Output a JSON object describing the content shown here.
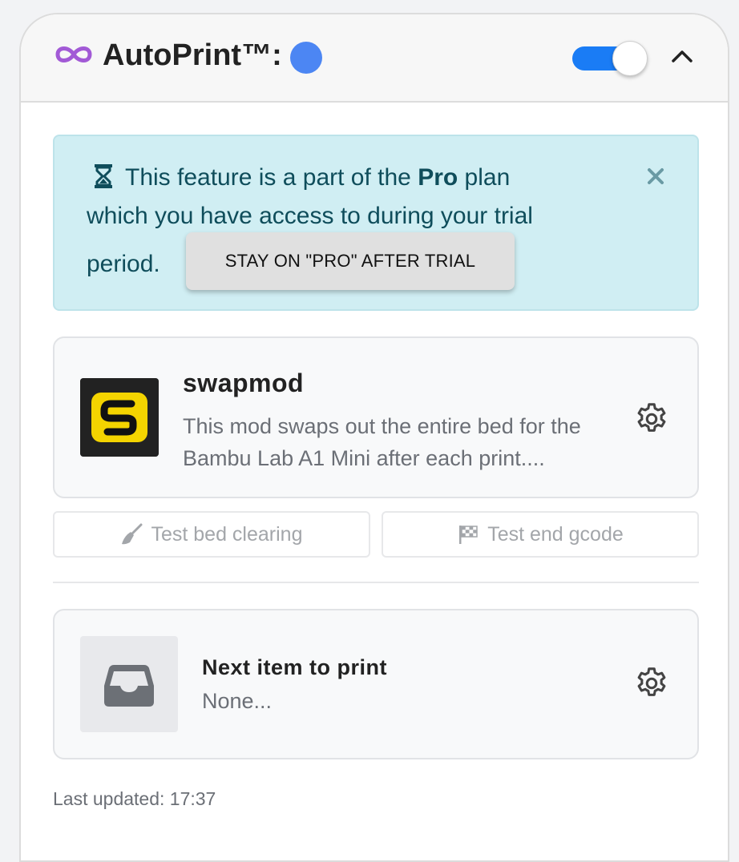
{
  "header": {
    "title": "AutoPrint™:",
    "status_color": "#4c86f3",
    "toggle_on": true,
    "accent_color": "#1a7cf5"
  },
  "alert": {
    "text_1": "This feature is a part of the ",
    "plan": "Pro",
    "text_2": " plan",
    "text_3": "which you have access to during your trial",
    "text_4": "period.",
    "button_label": "STAY ON \"PRO\" AFTER TRIAL",
    "icon": "hourglass-icon"
  },
  "mod": {
    "name": "swapmod",
    "description_1": "This mod swaps out the entire bed for the",
    "description_2": "Bambu Lab A1 Mini after each print...."
  },
  "actions": {
    "test_bed_label": "Test bed clearing",
    "test_gcode_label": "Test end gcode"
  },
  "next_item": {
    "title": "Next item to print",
    "value": "None..."
  },
  "footer": {
    "last_updated": "Last updated: 17:37"
  }
}
